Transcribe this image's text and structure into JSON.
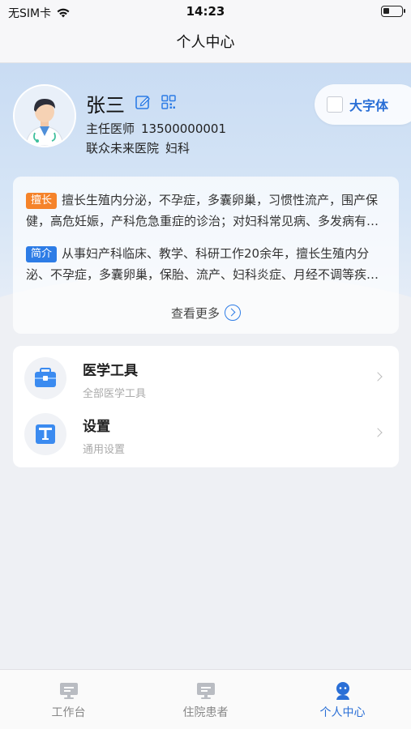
{
  "status_bar": {
    "carrier": "无SIM卡",
    "time": "14:23",
    "battery_level": 0.35
  },
  "nav": {
    "title": "个人中心"
  },
  "profile": {
    "name": "张三",
    "title": "主任医师",
    "phone": "13500000001",
    "hospital": "联众未来医院",
    "department": "妇科",
    "large_font_label": "大字体",
    "large_font_checked": false
  },
  "intro": {
    "specialty_tag": "擅长",
    "specialty_text": "擅长生殖内分泌，不孕症，多囊卵巢，习惯性流产，围产保健，高危妊娠，产科危急重症的诊治；对妇科常见病、多发病有丰富的临床经验",
    "bio_tag": "简介",
    "bio_text": "从事妇产科临床、教学、科研工作20余年，擅长生殖内分泌、不孕症，多囊卵巢，保胎、流产、妇科炎症、月经不调等疾病的诊治",
    "see_more": "查看更多"
  },
  "menu": [
    {
      "title": "医学工具",
      "subtitle": "全部医学工具",
      "icon": "toolbox-icon"
    },
    {
      "title": "设置",
      "subtitle": "通用设置",
      "icon": "settings-text-icon"
    }
  ],
  "tabs": [
    {
      "label": "工作台",
      "icon": "monitor-icon",
      "active": false
    },
    {
      "label": "住院患者",
      "icon": "monitor-icon",
      "active": false
    },
    {
      "label": "个人中心",
      "icon": "person-icon",
      "active": true
    }
  ],
  "colors": {
    "accent": "#2a6fd6",
    "tag_orange": "#f5832a",
    "tag_blue": "#2d7ce6"
  }
}
